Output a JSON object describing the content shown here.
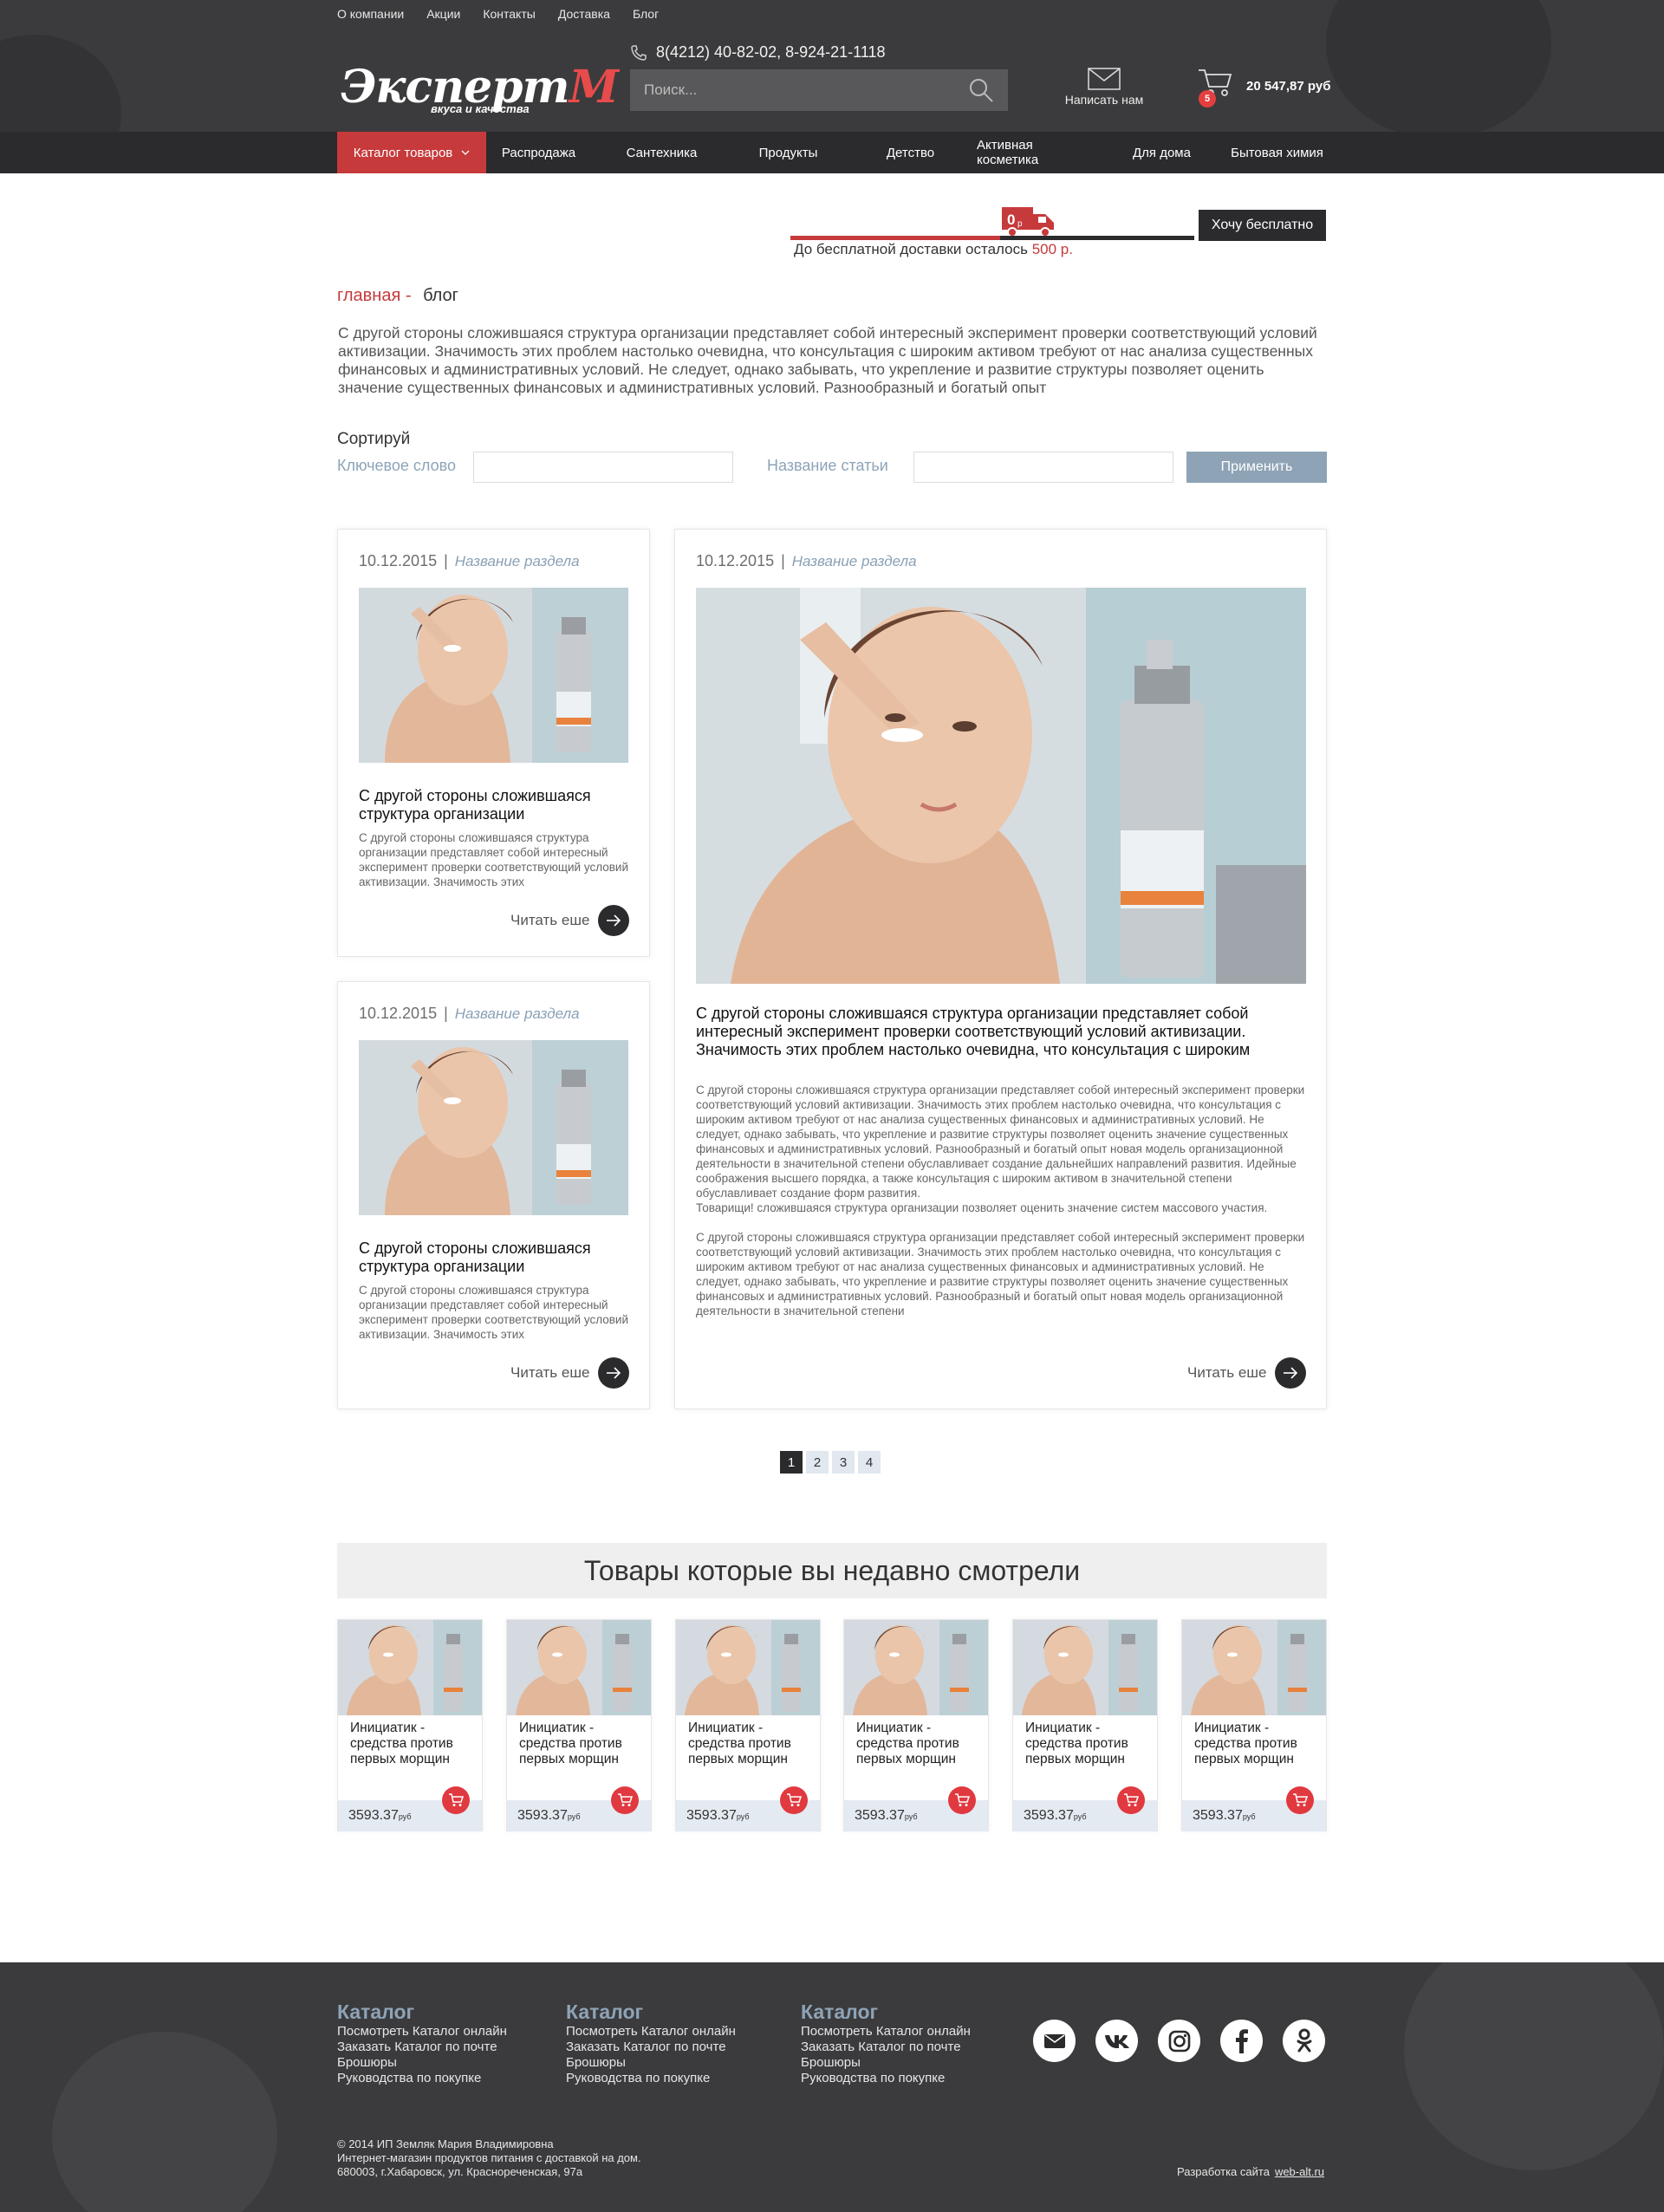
{
  "header": {
    "top_links": [
      "О компании",
      "Акции",
      "Контакты",
      "Доставка",
      "Блог"
    ],
    "logo_text": "Эксперт",
    "logo_letter": "М",
    "logo_tagline": "вкуса и качества",
    "phone": "8(4212) 40-82-02, 8-924-21-1118",
    "search_placeholder": "Поиск...",
    "write_us": "Написать нам",
    "cart_count": "5",
    "cart_sum": "20 547,87 руб"
  },
  "nav": {
    "items": [
      "Каталог товаров",
      "Распродажа",
      "Сантехника",
      "Продукты",
      "Детство",
      "Активная косметика",
      "Для дома",
      "Бытовая химия"
    ]
  },
  "delivery": {
    "truck_amount": "0",
    "truck_unit": "р",
    "text": "До бесплатной доставки осталось",
    "amount": "500 р.",
    "button": "Хочу бесплатно",
    "progress": 0.52
  },
  "breadcrumbs": {
    "home": "главная -",
    "current": "блог"
  },
  "intro": "С другой стороны сложившаяся структура организации представляет собой интересный эксперимент проверки соответствующий условий активизации. Значимость этих проблем настолько очевидна, что консультация с широким активом требуют от нас анализа существенных финансовых и административных условий. Не следует, однако забывать, что укрепление и развитие структуры позволяет оценить значение существенных финансовых и административных условий. Разнообразный и богатый опыт",
  "filters": {
    "sort_label": "Сортируй",
    "keyword_label": "Ключевое слово",
    "title_label": "Название статьи",
    "apply": "Применить"
  },
  "posts": {
    "small": [
      {
        "date": "10.12.2015",
        "section": "Название раздела",
        "title": "С другой стороны сложившаяся структура организации",
        "text": "С другой стороны сложившаяся структура организации представляет собой интересный эксперимент проверки соответствующий условий активизации. Значимость этих",
        "more": "Читать еше"
      },
      {
        "date": "10.12.2015",
        "section": "Название раздела",
        "title": "С другой стороны сложившаяся структура организации",
        "text": "С другой стороны сложившаяся структура организации представляет собой интересный эксперимент проверки соответствующий условий активизации. Значимость этих",
        "more": "Читать еше"
      }
    ],
    "big": {
      "date": "10.12.2015",
      "section": "Название раздела",
      "title": "С другой стороны сложившаяся структура организации представляет собой интересный эксперимент проверки соответствующий условий активизации. Значимость этих проблем настолько очевидна, что консультация с широким",
      "para1": "С другой стороны сложившаяся структура организации представляет собой интересный эксперимент проверки соответствующий условий активизации. Значимость этих проблем настолько очевидна, что консультация с широким активом требуют от нас анализа существенных финансовых и административных условий. Не следует, однако забывать, что укрепление и развитие структуры позволяет оценить значение существенных финансовых и административных условий. Разнообразный и богатый опыт новая модель организационной деятельности в значительной степени обуславливает создание дальнейших направлений развития. Идейные соображения высшего порядка, а также консультация с широким активом в значительной степени обуславливает создание форм развития.",
      "para2": "Товарищи! сложившаяся структура организации позволяет оценить значение систем массового участия.",
      "para3": "С другой стороны сложившаяся структура организации представляет собой интересный эксперимент проверки соответствующий условий активизации. Значимость этих проблем настолько очевидна, что консультация с широким активом требуют от нас анализа существенных финансовых и административных условий. Не следует, однако забывать, что укрепление и развитие структуры позволяет оценить значение существенных финансовых и административных условий. Разнообразный и богатый опыт новая модель организационной деятельности в значительной степени",
      "more": "Читать еше"
    }
  },
  "pager": [
    "1",
    "2",
    "3",
    "4"
  ],
  "recent": {
    "heading": "Товары которые вы недавно смотрели",
    "items": [
      {
        "name": "Инициатик - средства против первых морщин",
        "price": "3593.37",
        "unit": "руб"
      },
      {
        "name": "Инициатик - средства против первых морщин",
        "price": "3593.37",
        "unit": "руб"
      },
      {
        "name": "Инициатик - средства против первых морщин",
        "price": "3593.37",
        "unit": "руб"
      },
      {
        "name": "Инициатик - средства против первых морщин",
        "price": "3593.37",
        "unit": "руб"
      },
      {
        "name": "Инициатик - средства против первых морщин",
        "price": "3593.37",
        "unit": "руб"
      },
      {
        "name": "Инициатик - средства против первых морщин",
        "price": "3593.37",
        "unit": "руб"
      }
    ]
  },
  "footer": {
    "columns": [
      {
        "heading": "Каталог",
        "links": [
          "Посмотреть Каталог онлайн",
          "Заказать Каталог по почте",
          "Брошюры",
          "Руководства по покупке"
        ]
      },
      {
        "heading": "Каталог",
        "links": [
          "Посмотреть Каталог онлайн",
          "Заказать Каталог по почте",
          "Брошюры",
          "Руководства по покупке"
        ]
      },
      {
        "heading": "Каталог",
        "links": [
          "Посмотреть Каталог онлайн",
          "Заказать Каталог по почте",
          "Брошюры",
          "Руководства по покупке"
        ]
      }
    ],
    "socials": [
      "mail-icon",
      "vk-icon",
      "instagram-icon",
      "facebook-icon",
      "odnoklassniki-icon"
    ],
    "copyright": [
      "© 2014 ИП Земляк Мария Владимировна",
      "Интернет-магазин продуктов питания с доставкой на дом.",
      "680003, г.Хабаровск, ул. Краснореченская, 97а"
    ],
    "dev_label": "Разработка сайта",
    "dev_link": "web-alt.ru"
  },
  "colors": {
    "accent": "#c63a3c",
    "dark": "#2b2a2c",
    "header_bg": "#3b3b3d",
    "muted_blue": "#8ea3b5"
  }
}
